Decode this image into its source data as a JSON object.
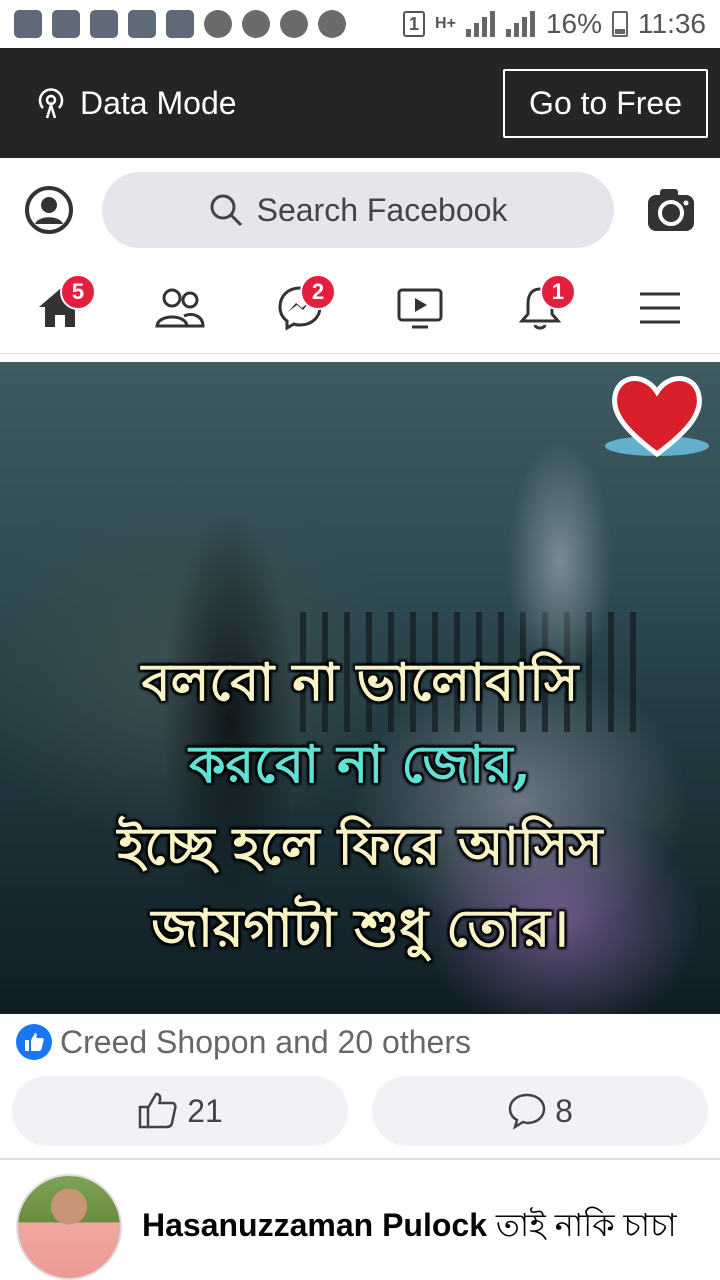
{
  "status_bar": {
    "sim": "1",
    "network": "H+",
    "battery": "16%",
    "time": "11:36"
  },
  "data_bar": {
    "mode_label": "Data Mode",
    "free_button": "Go to Free"
  },
  "search": {
    "placeholder": "Search Facebook"
  },
  "nav": {
    "home_badge": "5",
    "messenger_badge": "2",
    "notifications_badge": "1"
  },
  "post": {
    "image_text": [
      "বলবো না ভালোবাসি",
      "করবো না জোর,",
      "ইচ্ছে হলে ফিরে আসিস",
      "জায়গাটা শুধু তোর।"
    ],
    "reactions_text": "Creed Shopon and 20 others",
    "like_count": "21",
    "comment_count": "8"
  },
  "comment": {
    "author": "Hasanuzzaman Pulock",
    "text": "তাই নাকি চাচা"
  },
  "colors": {
    "dark_bar": "#242526",
    "badge": "#e41e3f",
    "like_blue": "#1877f2",
    "pill_bg": "#e4e6eb"
  }
}
